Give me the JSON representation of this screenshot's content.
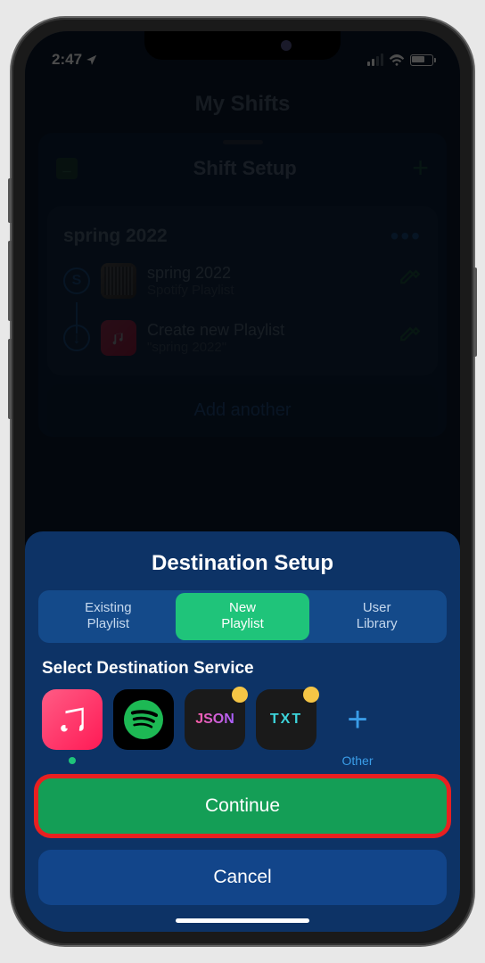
{
  "status": {
    "time": "2:47"
  },
  "bg": {
    "page_title": "My Shifts",
    "modal_title": "Shift Setup",
    "shift_name": "spring 2022",
    "source": {
      "title": "spring 2022",
      "subtitle": "Spotify Playlist"
    },
    "dest": {
      "title": "Create new Playlist",
      "subtitle": "\"spring 2022\""
    },
    "add_another": "Add another"
  },
  "sheet": {
    "title": "Destination Setup",
    "tabs": {
      "existing": "Existing\nPlaylist",
      "new": "New\nPlaylist",
      "user": "User\nLibrary"
    },
    "select_label": "Select Destination Service",
    "other_label": "Other",
    "continue": "Continue",
    "cancel": "Cancel",
    "json_text": "JSON",
    "txt_text": "TXT"
  }
}
